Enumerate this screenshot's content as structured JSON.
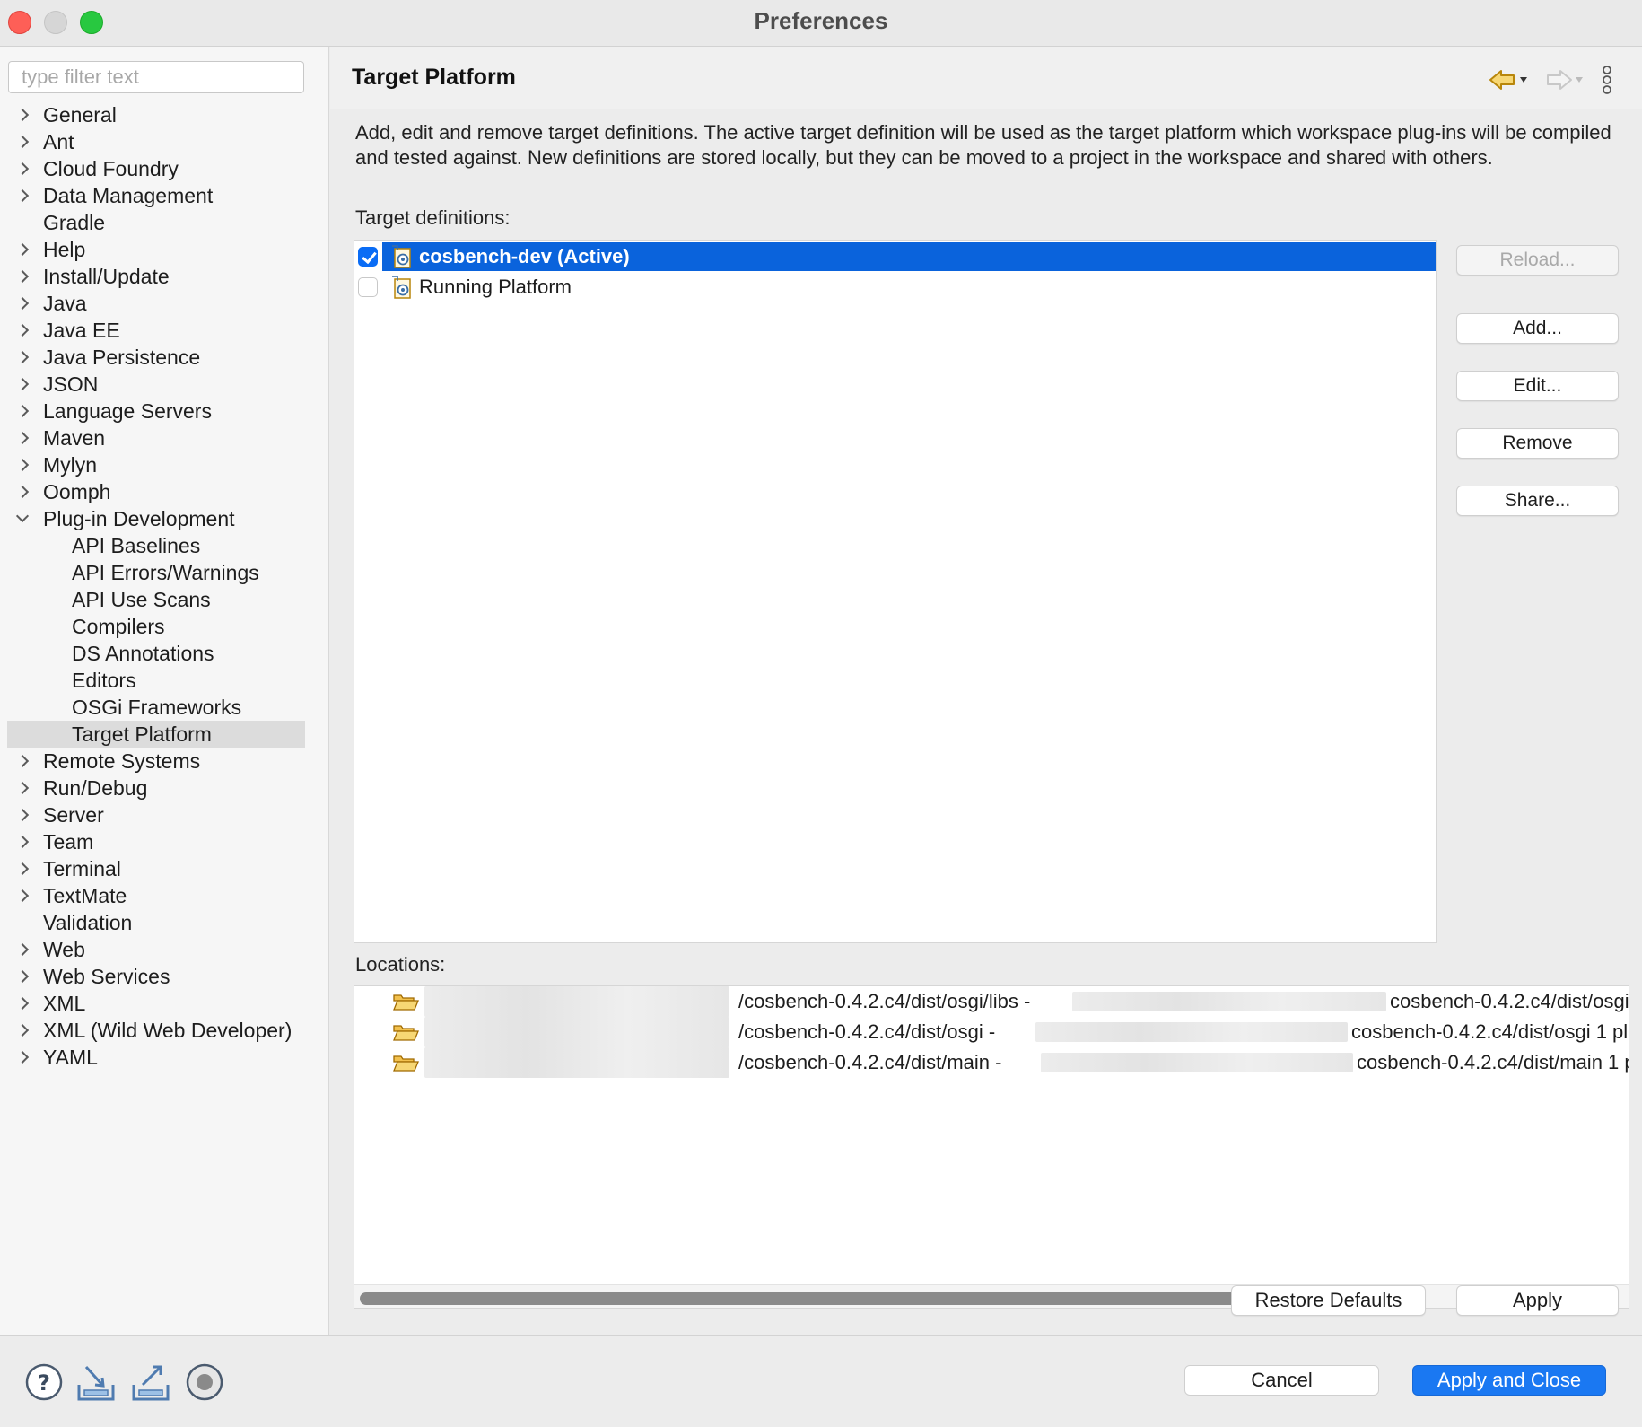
{
  "window": {
    "title": "Preferences"
  },
  "sidebar": {
    "filter_placeholder": "type filter text",
    "items": [
      {
        "label": "General",
        "expandable": true
      },
      {
        "label": "Ant",
        "expandable": true
      },
      {
        "label": "Cloud Foundry",
        "expandable": true
      },
      {
        "label": "Data Management",
        "expandable": true
      },
      {
        "label": "Gradle",
        "expandable": false
      },
      {
        "label": "Help",
        "expandable": true
      },
      {
        "label": "Install/Update",
        "expandable": true
      },
      {
        "label": "Java",
        "expandable": true
      },
      {
        "label": "Java EE",
        "expandable": true
      },
      {
        "label": "Java Persistence",
        "expandable": true
      },
      {
        "label": "JSON",
        "expandable": true
      },
      {
        "label": "Language Servers",
        "expandable": true
      },
      {
        "label": "Maven",
        "expandable": true
      },
      {
        "label": "Mylyn",
        "expandable": true
      },
      {
        "label": "Oomph",
        "expandable": true
      },
      {
        "label": "Plug-in Development",
        "expandable": true,
        "expanded": true
      },
      {
        "label": "API Baselines",
        "child": true
      },
      {
        "label": "API Errors/Warnings",
        "child": true
      },
      {
        "label": "API Use Scans",
        "child": true
      },
      {
        "label": "Compilers",
        "child": true
      },
      {
        "label": "DS Annotations",
        "child": true
      },
      {
        "label": "Editors",
        "child": true
      },
      {
        "label": "OSGi Frameworks",
        "child": true
      },
      {
        "label": "Target Platform",
        "child": true,
        "selected": true
      },
      {
        "label": "Remote Systems",
        "expandable": true
      },
      {
        "label": "Run/Debug",
        "expandable": true
      },
      {
        "label": "Server",
        "expandable": true
      },
      {
        "label": "Team",
        "expandable": true
      },
      {
        "label": "Terminal",
        "expandable": true
      },
      {
        "label": "TextMate",
        "expandable": true
      },
      {
        "label": "Validation",
        "expandable": false
      },
      {
        "label": "Web",
        "expandable": true
      },
      {
        "label": "Web Services",
        "expandable": true
      },
      {
        "label": "XML",
        "expandable": true
      },
      {
        "label": "XML (Wild Web Developer)",
        "expandable": true
      },
      {
        "label": "YAML",
        "expandable": true
      }
    ]
  },
  "page": {
    "title": "Target Platform",
    "description": "Add, edit and remove target definitions.  The active target definition will be used as the target platform which workspace plug-ins will be compiled and tested against.  New definitions are stored locally, but they can be moved to a project in the workspace and shared with others.",
    "targets_label": "Target definitions:",
    "targets": [
      {
        "label": "cosbench-dev (Active)",
        "checked": true,
        "selected": true
      },
      {
        "label": "Running Platform",
        "checked": false,
        "selected": false
      }
    ],
    "buttons": {
      "reload": "Reload...",
      "add": "Add...",
      "edit": "Edit...",
      "remove": "Remove",
      "share": "Share..."
    },
    "locations_label": "Locations:",
    "locations": [
      {
        "part1": "/cosbench-0.4.2.c4/dist/osgi/libs -",
        "part2": "cosbench-0.4.2.c4/dist/osgi"
      },
      {
        "part1": "/cosbench-0.4.2.c4/dist/osgi -",
        "part2": "cosbench-0.4.2.c4/dist/osgi 1 pl"
      },
      {
        "part1": "/cosbench-0.4.2.c4/dist/main -",
        "part2": "cosbench-0.4.2.c4/dist/main 1 p"
      }
    ],
    "restore_defaults": "Restore Defaults",
    "apply": "Apply"
  },
  "footer": {
    "cancel": "Cancel",
    "apply_and_close": "Apply and Close"
  },
  "colors": {
    "selection": "#0a63dc",
    "primary_button": "#1a78f2"
  }
}
